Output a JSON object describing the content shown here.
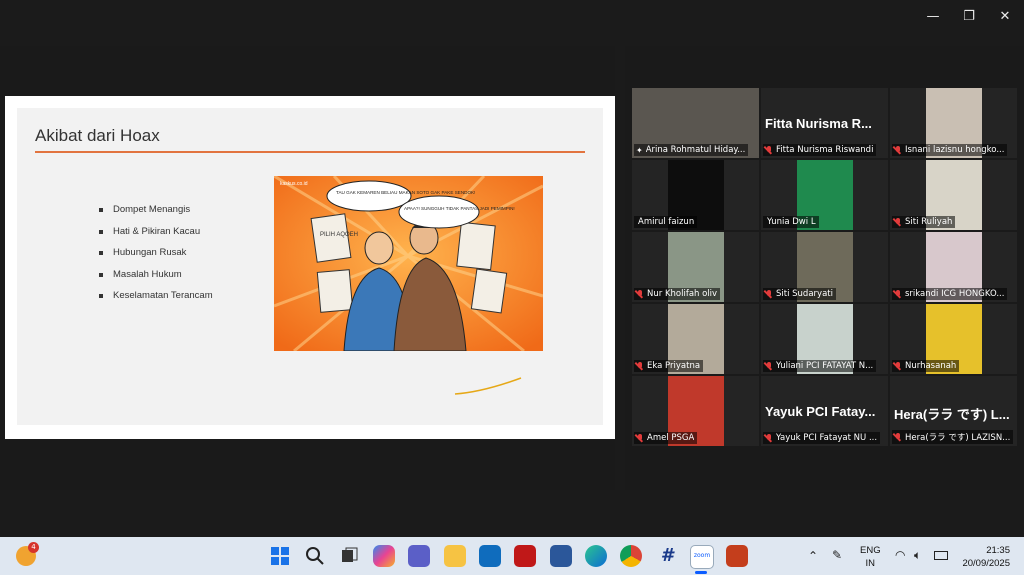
{
  "window": {
    "minimize": "—",
    "restore": "❐",
    "close": "✕"
  },
  "slide": {
    "title": "Akibat dari Hoax",
    "bullets": [
      "Dompet Menangis",
      "Hati & Pikiran Kacau",
      "Hubungan Rusak",
      "Masalah Hukum",
      "Keselamatan Terancam"
    ],
    "comic": {
      "bubble_left": "TAU GAK KEMAREN BELIAU MAKAN SOTO GAK PAKE SENDOK!",
      "bubble_right": "APAA?! SUNGGUH TIDAK PANTAS JADI PEMIMPIN!",
      "poster_text": "PILIH AQOEH",
      "watermark": "kaskus.co.id"
    }
  },
  "participants": [
    {
      "label": "Arina Rohmatul Hiday...",
      "icon": "pin-icon",
      "active": true,
      "video": "#5a5650"
    },
    {
      "label": "Fitta Nurisma Riswandi",
      "name_display": "Fitta Nurisma R...",
      "icon": "muted-mic-icon"
    },
    {
      "label": "Isnani lazisnu hongko...",
      "icon": "muted-mic-icon",
      "video": "#c9bfb3"
    },
    {
      "label": "Amirul faizun",
      "icon": "",
      "video": "#0d0d0d"
    },
    {
      "label": "Yunia Dwi L",
      "icon": "",
      "video": "#1f8a4e"
    },
    {
      "label": "Siti Ruliyah",
      "icon": "muted-mic-icon",
      "video": "#d8d4c8"
    },
    {
      "label": "Nur Kholifah oliv",
      "icon": "muted-mic-icon",
      "video": "#8a9686"
    },
    {
      "label": "Siti Sudaryati",
      "icon": "muted-mic-icon",
      "video": "#6e6a5a"
    },
    {
      "label": "srikandi ICG HONGKO...",
      "icon": "muted-mic-icon",
      "video": "#d8c8cc"
    },
    {
      "label": "Eka Priyatna",
      "icon": "muted-mic-icon",
      "video": "#b3aa9a"
    },
    {
      "label": "Yuliani PCI FATAYAT N...",
      "icon": "muted-mic-icon",
      "video": "#c8d2cc"
    },
    {
      "label": "Nurhasanah",
      "icon": "muted-mic-icon",
      "video": "#e6c12b"
    },
    {
      "label": "Amel PSGA",
      "icon": "muted-mic-icon",
      "video": "#c0392b"
    },
    {
      "label": "Yayuk PCI Fatayat NU ...",
      "name_display": "Yayuk PCI Fatay...",
      "icon": "muted-mic-icon"
    },
    {
      "label": "Hera(ララ です) LAZISN...",
      "name_display": "Hera(ララ です) L...",
      "icon": "muted-mic-icon"
    }
  ],
  "taskbar": {
    "notification_badge": "4",
    "apps": [
      "start-icon",
      "search-icon",
      "task-view-icon",
      "copilot-icon",
      "teams-icon",
      "file-explorer-icon",
      "outlook-icon",
      "mcafee-icon",
      "store-icon",
      "edge-icon",
      "chrome-icon",
      "hashtag-app-icon",
      "zoom-icon",
      "powerpoint-icon"
    ],
    "zoom_label": "zoom",
    "lang_line1": "ENG",
    "lang_line2": "IN",
    "time": "21:35",
    "date": "20/09/2025"
  }
}
